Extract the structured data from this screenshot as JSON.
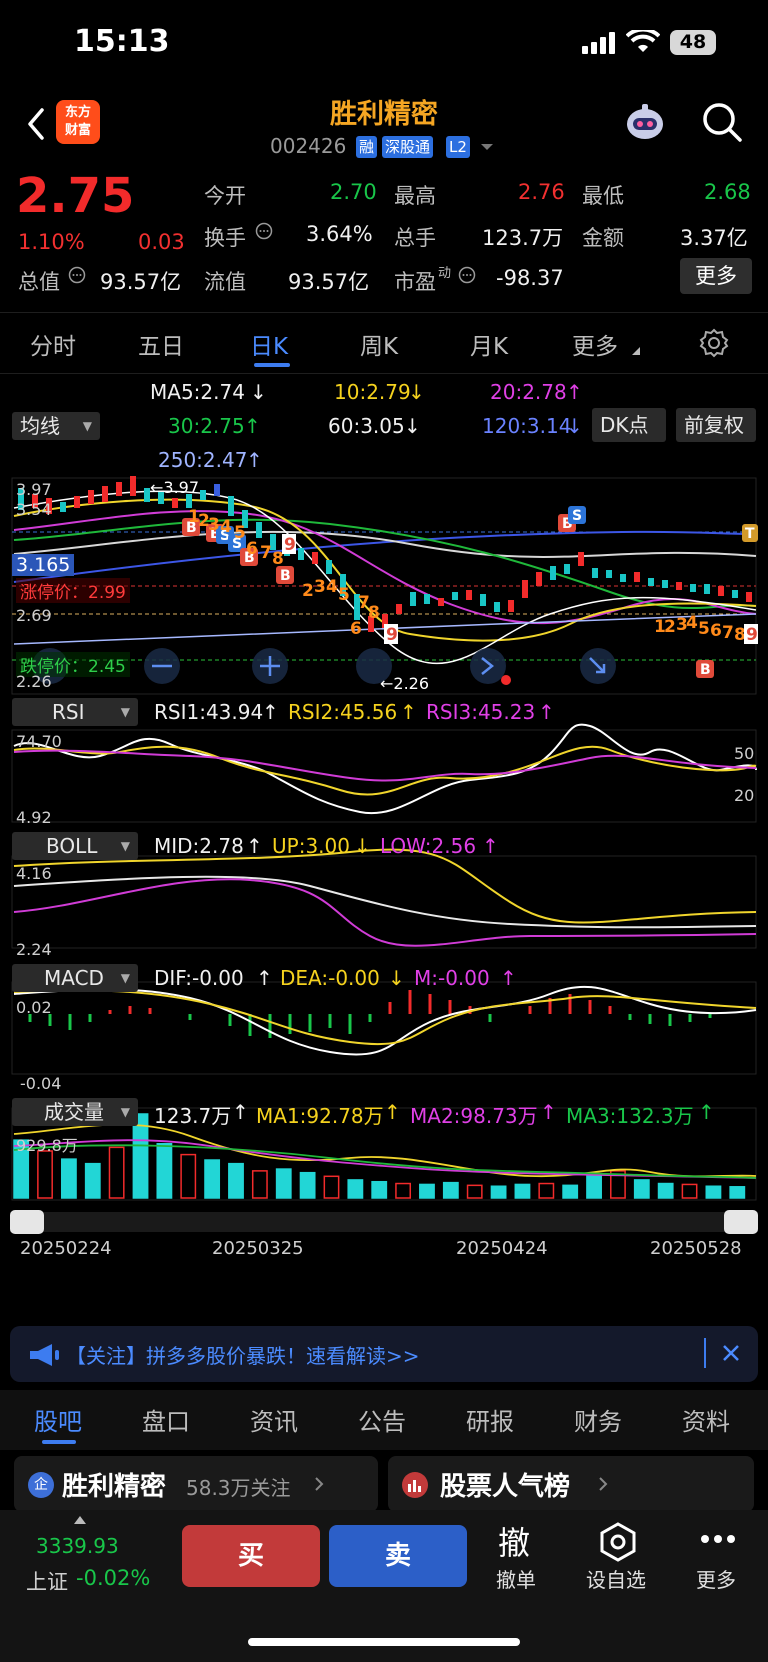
{
  "status_bar": {
    "time": "15:13",
    "battery": "48"
  },
  "header": {
    "logo_text": [
      "东方",
      "财富"
    ],
    "stock_name": "胜利精密",
    "stock_code": "002426",
    "tags": [
      "融",
      "深股通",
      "L2"
    ]
  },
  "quote": {
    "price": "2.75",
    "change_pct": "1.10%",
    "change": "0.03",
    "open_label": "今开",
    "open": "2.70",
    "high_label": "最高",
    "high": "2.76",
    "low_label": "最低",
    "low": "2.68",
    "turnover_label": "换手",
    "turnover": "3.64%",
    "volume_label": "总手",
    "volume": "123.7万",
    "amount_label": "金额",
    "amount": "3.37亿",
    "mktcap_label": "总值",
    "mktcap": "93.57亿",
    "float_label": "流值",
    "float": "93.57亿",
    "pe_label": "市盈",
    "pe_sup": "动",
    "pe": "-98.37",
    "more": "更多"
  },
  "period_tabs": [
    "分时",
    "五日",
    "日K",
    "周K",
    "月K",
    "更多"
  ],
  "ma_panel": {
    "selector": "均线",
    "ma5": "MA5:2.74",
    "ma10": "10:2.79",
    "ma20": "20:2.78",
    "ma30": "30:2.75",
    "ma60": "60:3.05",
    "ma120": "120:3.14",
    "ma250": "250:2.47",
    "dk_button": "DK点",
    "fq_button": "前复权"
  },
  "kline_labels": {
    "top": "3.97",
    "high_mark": "3.97",
    "y2": "3.54",
    "current_line": "3.165",
    "limit_up": "涨停价：2.99",
    "y3": "2.69",
    "limit_down": "跌停价：2.45",
    "bottom": "2.26",
    "low_mark": "2.26"
  },
  "rsi": {
    "selector": "RSI",
    "rsi1": "RSI1:43.94",
    "rsi2": "RSI2:45.56",
    "rsi3": "RSI3:45.23",
    "top": "74.70",
    "bottom": "4.92",
    "r50": "50",
    "r20": "20"
  },
  "boll": {
    "selector": "BOLL",
    "mid": "MID:2.78",
    "up": "UP:3.00",
    "low": "LOW:2.56",
    "top": "4.16",
    "bottom": "2.24"
  },
  "macd": {
    "selector": "MACD",
    "dif": "DIF:-0.00",
    "dea": "DEA:-0.00",
    "m": "M:-0.00",
    "top": "0.02",
    "bottom": "-0.04"
  },
  "volume_panel": {
    "selector": "成交量",
    "vol": "123.7万",
    "ma1": "MA1:92.78万",
    "ma2": "MA2:98.73万",
    "ma3": "MA3:132.3万",
    "top": "929.8万"
  },
  "dates": [
    "20250224",
    "20250325",
    "20250424",
    "20250528"
  ],
  "banner": "【关注】拼多多股价暴跌！速看解读>>",
  "bottom_tabs": [
    "股吧",
    "盘口",
    "资讯",
    "公告",
    "研报",
    "财务",
    "资料"
  ],
  "cards": {
    "left_name": "胜利精密",
    "left_follow": "58.3万关注",
    "right_name": "股票人气榜"
  },
  "bottom_bar": {
    "index_value": "3339.93",
    "index_name": "上证",
    "index_change": "-0.02%",
    "buy": "买",
    "sell": "卖",
    "cancel_icon": "撤",
    "cancel": "撤单",
    "watch": "设自选",
    "more": "更多"
  },
  "colors": {
    "up": "#f22b2b",
    "down": "#19c64a",
    "accent": "#4b8bff",
    "brand": "#ff4d1a"
  },
  "chart_data": [
    {
      "type": "line",
      "name": "RSI",
      "series": [
        {
          "name": "RSI1",
          "values": [
            60,
            58,
            52,
            64,
            48,
            66,
            40,
            36,
            28,
            34,
            30,
            48,
            44,
            40,
            42,
            56,
            74,
            70,
            56,
            62,
            48,
            50,
            44,
            46
          ]
        },
        {
          "name": "RSI2",
          "values": [
            58,
            56,
            54,
            60,
            52,
            60,
            46,
            42,
            36,
            38,
            36,
            44,
            44,
            42,
            42,
            50,
            62,
            62,
            56,
            58,
            50,
            50,
            48,
            46
          ]
        },
        {
          "name": "RSI3",
          "values": [
            58,
            57,
            56,
            58,
            56,
            58,
            50,
            48,
            44,
            44,
            42,
            44,
            44,
            44,
            44,
            48,
            54,
            56,
            54,
            54,
            50,
            50,
            48,
            46
          ]
        }
      ]
    },
    {
      "type": "bar",
      "name": "成交量",
      "values": [
        640,
        520,
        430,
        380,
        560,
        929,
        600,
        480,
        420,
        380,
        300,
        320,
        280,
        240,
        200,
        180,
        160,
        150,
        170,
        140,
        130,
        150,
        160,
        140,
        260,
        300,
        200,
        160,
        150,
        130,
        124
      ]
    }
  ]
}
